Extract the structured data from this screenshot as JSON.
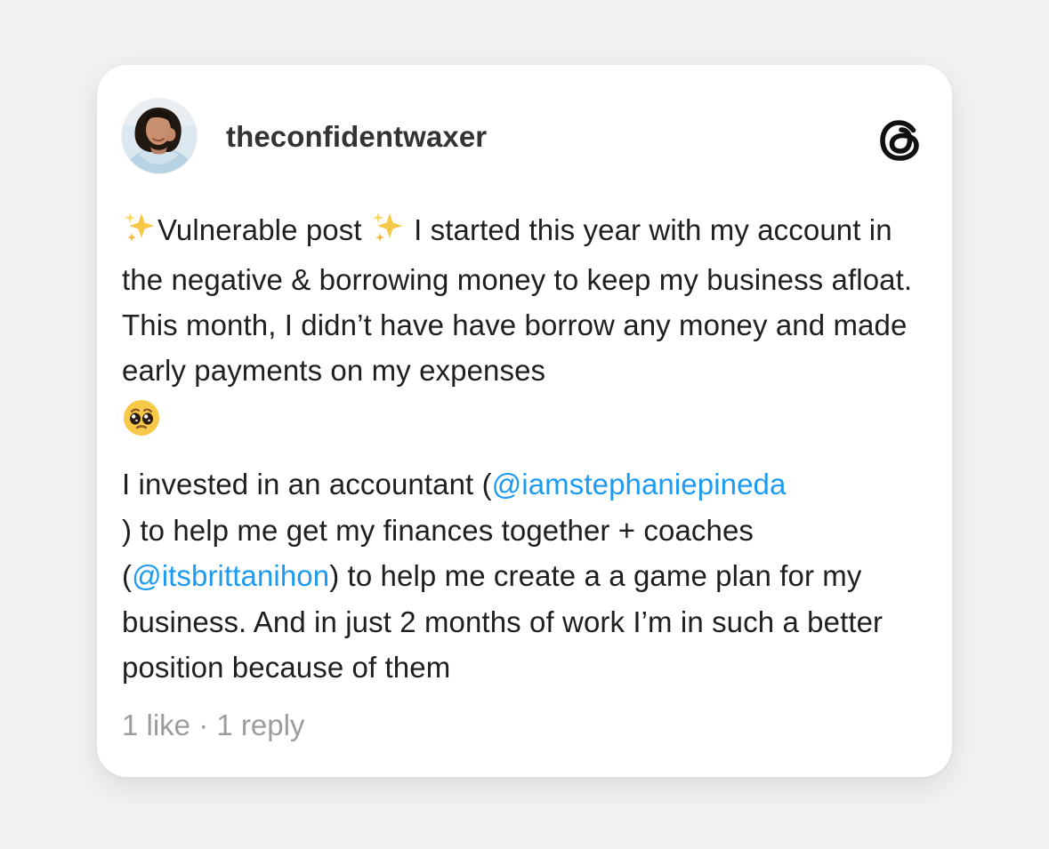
{
  "post": {
    "author": {
      "username": "theconfidentwaxer",
      "avatar_icon": "profile-photo"
    },
    "app_logo_icon": "threads-logo-icon",
    "paragraph1": {
      "after_first_sparkle": "Vulnerable post ",
      "after_second_sparkle": " I started this year with my account in the negative & borrowing money to keep my business afloat. This month, I didn’t have have borrow any money and made early payments on my expenses",
      "emoji_icons": [
        "sparkles-icon",
        "sparkles-icon",
        "pleading-face-icon"
      ]
    },
    "paragraph2": {
      "before_mention1": "I invested in an accountant (",
      "mention1": "@iamstephaniepineda",
      "between_mentions": ") to help me get my finances together + coaches (",
      "mention2": "@itsbrittanihon",
      "after_mention2": ") to help me create a a game plan for my business. And in just 2 months of work I’m in such a better position because of them"
    },
    "stats": {
      "likes": "1 like",
      "separator": " · ",
      "replies": "1 reply"
    }
  },
  "colors": {
    "background": "#f2f2f2",
    "card": "#ffffff",
    "text": "#1f1f1f",
    "username": "#333333",
    "mention": "#1d9bf0",
    "meta": "#9c9c9c"
  }
}
